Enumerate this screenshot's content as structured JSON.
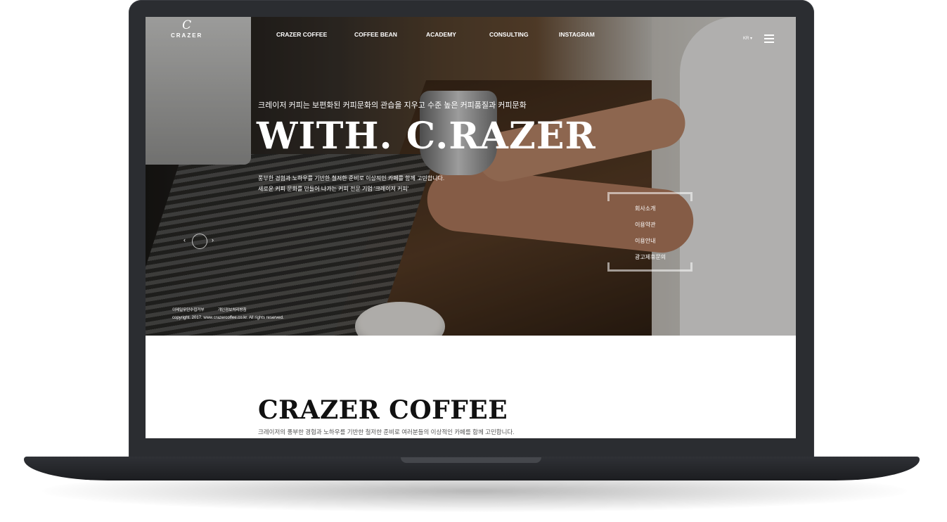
{
  "header": {
    "logo_mark": "C",
    "logo_text": "CRAZER",
    "nav": [
      "CRAZER COFFEE",
      "COFFEE BEAN",
      "ACADEMY",
      "CONSULTING",
      "INSTAGRAM"
    ],
    "lang": "KR ▾"
  },
  "hero": {
    "tagline": "크레이저 커피는 보편화된 커피문화의 관습을 지우고 수준 높은 커피품질과 커피문화",
    "headline": "WITH. C.RAZER",
    "desc_line1": "풍부한 경험과 노하우를 기반한 철저한 준비로 이상적인 카페를 함께 고민합니다.",
    "desc_line2": "새로운 커피 문화를 만들어 나가는 커피 전문 기업 '크레이저 커피'",
    "slider_prev": "‹",
    "slider_next": "›"
  },
  "side_menu": [
    "회사소개",
    "이용약관",
    "이용안내",
    "광고제휴문의"
  ],
  "footer": {
    "link1": "이메일무단수집거부",
    "link2": "개인정보처리방침",
    "copyright": "copyright. 2017. www.crazercoffee.co.kr. All rights reserved."
  },
  "content": {
    "title": "CRAZER COFFEE",
    "desc": "크레이저의 풍부한 경험과 노하우를 기반한 철저한 준비로 여러분들의 이상적인 카페를 함께 고민합니다."
  }
}
